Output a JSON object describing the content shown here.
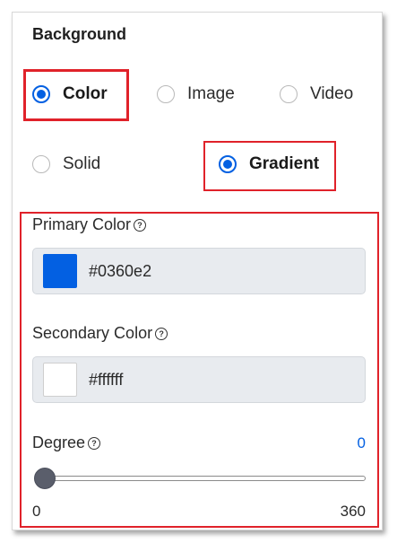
{
  "section_title": "Background",
  "type_options": [
    {
      "label": "Color",
      "selected": true
    },
    {
      "label": "Image",
      "selected": false
    },
    {
      "label": "Video",
      "selected": false
    }
  ],
  "fill_options": [
    {
      "label": "Solid",
      "selected": false
    },
    {
      "label": "Gradient",
      "selected": true
    }
  ],
  "primary_color": {
    "label": "Primary Color",
    "value": "#0360e2",
    "swatch": "#0360e2"
  },
  "secondary_color": {
    "label": "Secondary Color",
    "value": "#ffffff",
    "swatch": "#ffffff"
  },
  "degree": {
    "label": "Degree",
    "value": "0",
    "min": "0",
    "max": "360",
    "value_color": "#0360e2"
  },
  "help_icon_glyph": "?",
  "colors": {
    "accent": "#0360e2",
    "highlight": "#e0222a"
  }
}
